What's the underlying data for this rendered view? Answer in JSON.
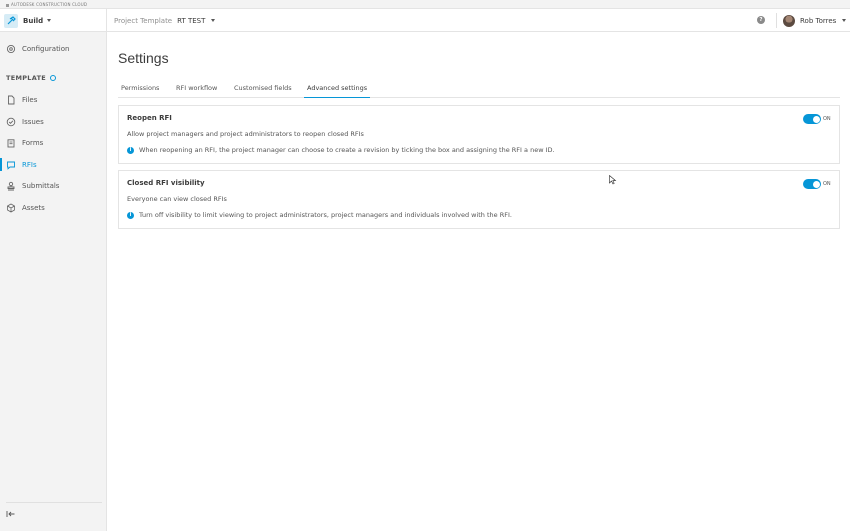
{
  "brand": {
    "text": "AUTODESK CONSTRUCTION CLOUD"
  },
  "header": {
    "app_name": "Build",
    "project_label": "Project Template",
    "project_name": "RT TEST",
    "help_glyph": "?",
    "user_name": "Rob Torres"
  },
  "sidebar": {
    "top_item": "Configuration",
    "section_label": "TEMPLATE",
    "items": [
      {
        "label": "Files",
        "icon": "file-icon"
      },
      {
        "label": "Issues",
        "icon": "check-circle-icon"
      },
      {
        "label": "Forms",
        "icon": "clipboard-icon"
      },
      {
        "label": "RFIs",
        "icon": "chat-icon",
        "active": true
      },
      {
        "label": "Submittals",
        "icon": "stamp-icon"
      },
      {
        "label": "Assets",
        "icon": "cube-icon"
      }
    ]
  },
  "main": {
    "title": "Settings",
    "tabs": [
      {
        "label": "Permissions"
      },
      {
        "label": "RFI workflow"
      },
      {
        "label": "Customised fields"
      },
      {
        "label": "Advanced settings",
        "active": true
      }
    ],
    "cards": [
      {
        "title": "Reopen RFI",
        "description": "Allow project managers and project administrators to reopen closed RFIs",
        "note": "When reopening an RFI, the project manager can choose to create a revision by ticking the box and assigning the RFI a new ID.",
        "toggle_label": "ON",
        "toggle_on": true
      },
      {
        "title": "Closed RFI visibility",
        "description": "Everyone can view closed RFIs",
        "note": "Turn off visibility to limit viewing to project administrators, project managers and individuals involved with the RFI.",
        "toggle_label": "ON",
        "toggle_on": true
      }
    ],
    "info_glyph": "i"
  },
  "colors": {
    "accent": "#0696d7",
    "sidebar_bg": "#f3f3f3",
    "text": "#3c3c3c"
  }
}
